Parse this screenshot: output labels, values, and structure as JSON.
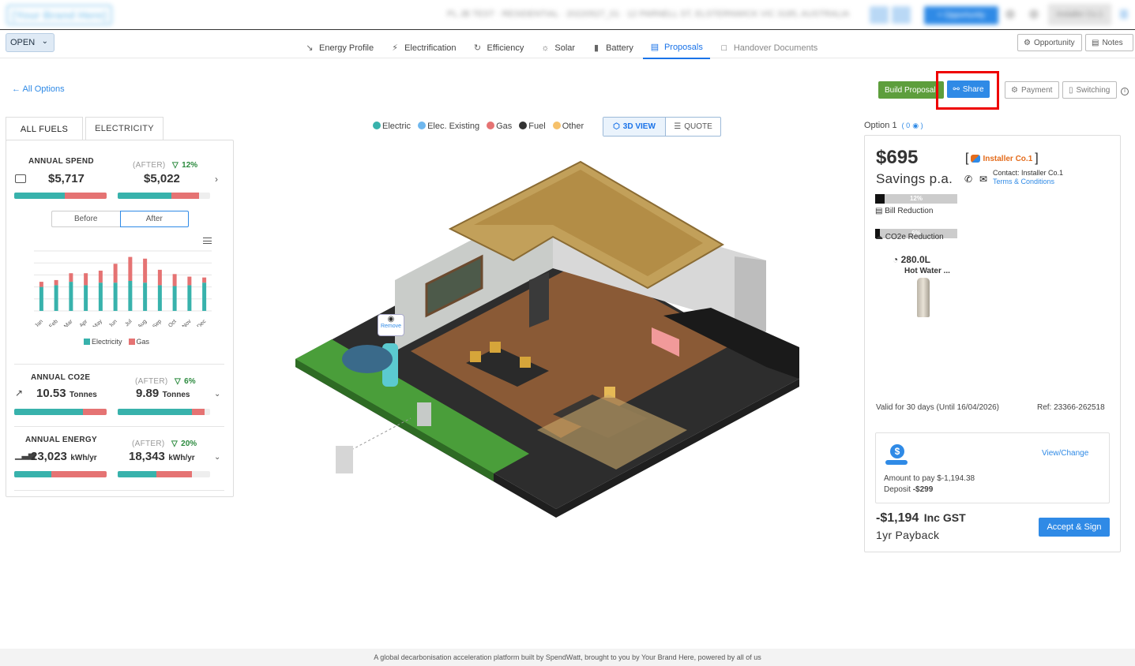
{
  "header": {
    "brand": "[Your Brand Here]",
    "crumbs": "PL JB TEST  ·  RESIDENTIAL  ·  20220527_01  ·  12 PARNELL ST, ELSTERNWICK VIC 3185, AUSTRALIA",
    "opportunity_button": "+ Opportunity",
    "user_name": "Installer Co.1"
  },
  "nav": {
    "status": "OPEN",
    "tabs": [
      {
        "label": "Energy Profile"
      },
      {
        "label": "Electrification"
      },
      {
        "label": "Efficiency"
      },
      {
        "label": "Solar"
      },
      {
        "label": "Battery"
      },
      {
        "label": "Proposals"
      },
      {
        "label": "Handover Documents"
      }
    ],
    "opportunity": "Opportunity",
    "notes": "Notes"
  },
  "actions": {
    "all_options": "All Options",
    "build_proposal": "Build Proposal",
    "share": "Share",
    "payment": "Payment",
    "switching": "Switching"
  },
  "left": {
    "tabs": [
      "ALL FUELS",
      "ELECTRICITY"
    ],
    "spend": {
      "label": "ANNUAL SPEND",
      "after_label": "(AFTER)",
      "pct": "12%",
      "before": "$5,717",
      "after": "$5,022",
      "before_e": 0.55,
      "after_e": 0.58,
      "after_total": 0.88
    },
    "toggle": [
      "Before",
      "After"
    ],
    "chart_data": {
      "type": "bar",
      "categories": [
        "Jan",
        "Feb",
        "Mar",
        "Apr",
        "May",
        "Jun",
        "Jul",
        "Aug",
        "Sep",
        "Oct",
        "Nov",
        "Dec"
      ],
      "series": [
        {
          "name": "Electricity",
          "values": [
            28,
            30,
            34,
            30,
            33,
            33,
            35,
            33,
            30,
            29,
            30,
            33
          ],
          "color": "#38b2ac"
        },
        {
          "name": "Gas",
          "values": [
            6,
            6,
            10,
            14,
            14,
            22,
            28,
            28,
            18,
            14,
            10,
            6
          ],
          "color": "#e57373"
        }
      ],
      "legend_position": "bottom"
    },
    "co2": {
      "label": "ANNUAL CO2E",
      "after_label": "(AFTER)",
      "pct": "6%",
      "before": "10.53",
      "after": "9.89",
      "unit": "Tonnes",
      "before_e": 0.74,
      "after_e": 0.8,
      "after_total": 0.94
    },
    "energy": {
      "label": "ANNUAL ENERGY",
      "after_label": "(AFTER)",
      "pct": "20%",
      "before": "23,023",
      "after": "18,343",
      "unit": "kWh/yr",
      "before_e": 0.4,
      "after_e": 0.42,
      "after_total": 0.8
    }
  },
  "center": {
    "legend": [
      {
        "label": "Electric",
        "color": "#38b2ac"
      },
      {
        "label": "Elec. Existing",
        "color": "#6fb7ee"
      },
      {
        "label": "Gas",
        "color": "#e57373"
      },
      {
        "label": "Fuel",
        "color": "#333333"
      },
      {
        "label": "Other",
        "color": "#f6c16b"
      }
    ],
    "view_3d": "3D VIEW",
    "view_quote": "QUOTE",
    "remove": "Remove"
  },
  "right": {
    "option": "Option 1",
    "option_count": "( 0",
    "savings": "$695",
    "savings_label": "Savings p.a.",
    "installer": "Installer Co.1",
    "contact": "Contact: Installer Co.1",
    "terms": "Terms & Conditions",
    "bill_pct": "12%",
    "bill_fill": 0.12,
    "bill_label": "Bill Reduction",
    "co2_pct": "6%",
    "co2_fill": 0.06,
    "co2_label": "CO2e Reduction",
    "product_size": "280.0L",
    "product_name": "Hot Water ...",
    "valid": "Valid for 30 days (Until 16/04/2026)",
    "ref": "Ref: 23366-262518",
    "view_change": "View/Change",
    "amount": "Amount to pay $-1,194.38",
    "deposit_label": "Deposit",
    "deposit": "-$299",
    "total": "-$1,194",
    "total_suffix": "Inc GST",
    "payback": "1yr Payback",
    "accept": "Accept & Sign"
  },
  "footer": "A global decarbonisation acceleration platform built by SpendWatt, brought to you by Your Brand Here, powered by all of us"
}
